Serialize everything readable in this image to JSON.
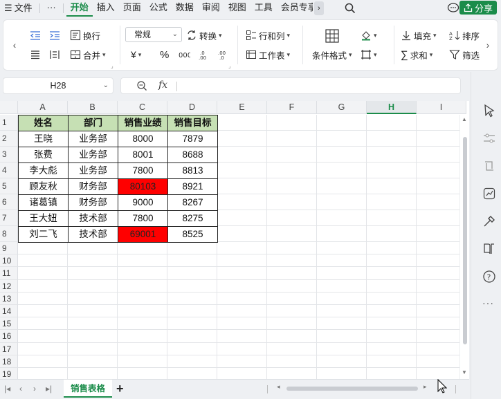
{
  "menu": {
    "file": "文件",
    "more": "···",
    "tabs": [
      "开始",
      "插入",
      "页面",
      "公式",
      "数据",
      "审阅",
      "视图",
      "工具",
      "会员专享"
    ],
    "active_tab": 0,
    "share": "分享"
  },
  "ribbon": {
    "wrap": "换行",
    "merge": "合并",
    "number_format": "常规",
    "convert": "转换",
    "currency": "¥",
    "percent": "%",
    "rows_cols": "行和列",
    "worksheet": "工作表",
    "cond_format": "条件格式",
    "fill": "填充",
    "sort": "排序",
    "sum": "求和",
    "filter": "筛选"
  },
  "formula_bar": {
    "cell_ref": "H28",
    "fx": "fx",
    "value": ""
  },
  "sheet": {
    "columns": [
      "A",
      "B",
      "C",
      "D",
      "E",
      "F",
      "G",
      "H",
      "I"
    ],
    "selected_column": "H",
    "row_numbers": [
      "1",
      "2",
      "3",
      "4",
      "5",
      "6",
      "7",
      "8",
      "9",
      "10",
      "11",
      "12",
      "13",
      "14",
      "15",
      "16",
      "17",
      "18",
      "19"
    ],
    "headers": [
      "姓名",
      "部门",
      "销售业绩",
      "销售目标"
    ],
    "rows": [
      [
        "王晓",
        "业务部",
        "8000",
        "7879"
      ],
      [
        "张费",
        "业务部",
        "8001",
        "8688"
      ],
      [
        "李大彪",
        "业务部",
        "7800",
        "8813"
      ],
      [
        "顾友秋",
        "财务部",
        "80103",
        "8921"
      ],
      [
        "诸葛镇",
        "财务部",
        "9000",
        "8267"
      ],
      [
        "王大妞",
        "技术部",
        "7800",
        "8275"
      ],
      [
        "刘二飞",
        "技术部",
        "69001",
        "8525"
      ]
    ],
    "highlight_color": "#ff0000",
    "header_color": "#c6e0b4"
  },
  "tabs": {
    "sheet_name": "销售表格",
    "add": "+"
  },
  "colors": {
    "accent": "#1b8c4a"
  }
}
